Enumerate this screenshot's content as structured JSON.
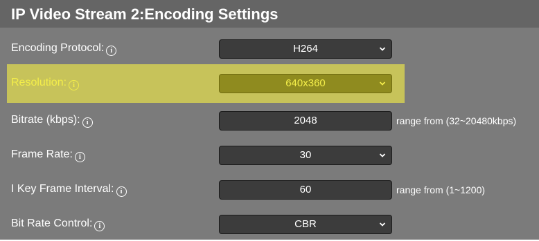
{
  "title": "IP Video Stream 2:Encoding Settings",
  "rows": [
    {
      "label": "Encoding Protocol:",
      "value": "H264",
      "type": "select"
    },
    {
      "label": "Resolution:",
      "value": "640x360",
      "type": "select",
      "highlighted": true
    },
    {
      "label": "Bitrate (kbps):",
      "value": "2048",
      "type": "input",
      "range": "range from (32~20480kbps)"
    },
    {
      "label": "Frame Rate:",
      "value": "30",
      "type": "select"
    },
    {
      "label": "I Key Frame Interval:",
      "value": "60",
      "type": "input",
      "range": "range from (1~1200)"
    },
    {
      "label": "Bit Rate Control:",
      "value": "CBR",
      "type": "select"
    }
  ],
  "icons": {
    "info": "info-icon",
    "dropdown": "chevron-down-icon"
  },
  "colors": {
    "panel": "#7b7b7b",
    "title_bar": "#656565",
    "highlight": "#c7c35a",
    "highlight_text": "#f4ee4a",
    "control": "#3c3c3c"
  }
}
